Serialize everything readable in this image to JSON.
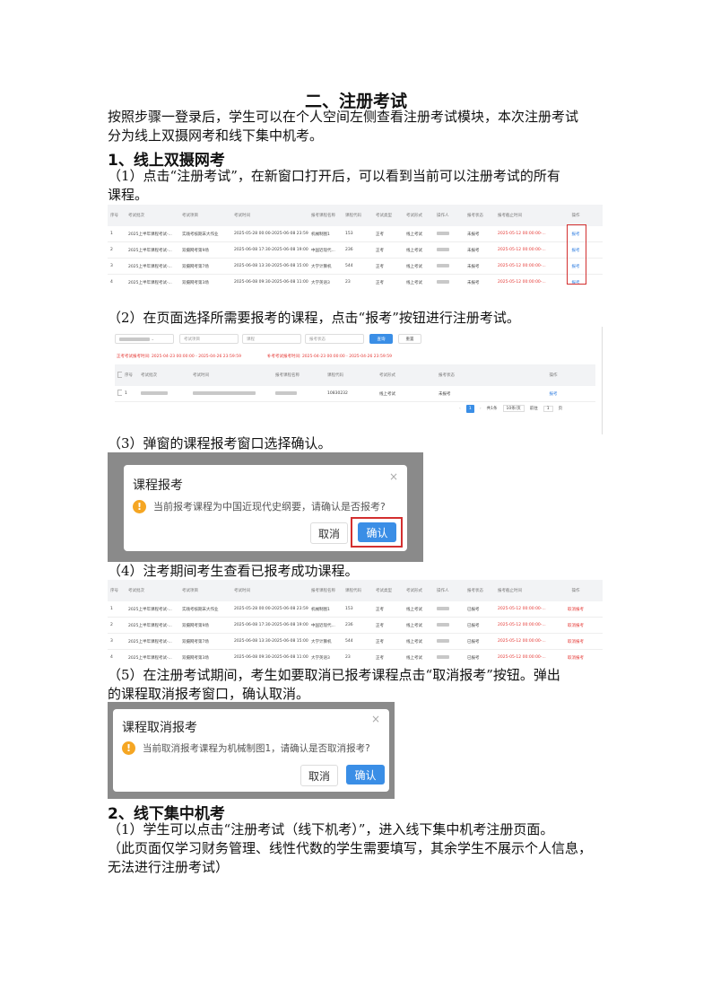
{
  "section_title": "二、注册考试",
  "intro": [
    "按照步骤一登录后，学生可以在个人空间左侧查看注册考试模块，本次注册考试",
    "分为线上双摄网考和线下集中机考。"
  ],
  "online": {
    "heading": "1、线上双摄网考",
    "step1": [
      "（1）点击“注册考试”，在新窗口打开后，可以看到当前可以注册考试的所有",
      "课程。"
    ],
    "step2": "（2）在页面选择所需要报考的课程，点击“报考”按钮进行注册考试。",
    "step3": "（3）弹窗的课程报考窗口选择确认。",
    "step4": "（4）注考期间考生查看已报考成功课程。",
    "step5": [
      "（5）在注册考试期间，考生如要取消已报考课程点击“取消报考”按钮。弹出",
      "的课程取消报考窗口，确认取消。"
    ]
  },
  "offline": {
    "heading": "2、线下集中机考",
    "step1": [
      "（1）学生可以点击“注册考试（线下机考）”，进入线下集中机考注册页面。",
      "（此页面仅学习财务管理、线性代数的学生需要填写，其余学生不展示个人信息，",
      "无法进行注册考试）"
    ]
  },
  "table1": {
    "headers": [
      "序号",
      "考试批次",
      "考试项目",
      "考试时间",
      "报考课程名称",
      "课程代码",
      "考试类型",
      "考试形式",
      "操作人",
      "报考状态",
      "报考截止时间",
      "操作"
    ],
    "rows": [
      [
        "1",
        "2025上半年课程考试-...",
        "实践考核期末大作业",
        "2025-05-28 00:00-2025-06-08 23:59",
        "机械制图1",
        "153",
        "正考",
        "线上考试",
        "",
        "未报考",
        "2025-05-12 00:00:00-...",
        "报考"
      ],
      [
        "2",
        "2025上半年课程考试-...",
        "双摄网考第9场",
        "2025-06-08 17:30-2025-06-08 19:00",
        "中国近现代...",
        "236",
        "正考",
        "线上考试",
        "",
        "未报考",
        "2025-05-12 00:00:00-...",
        "报考"
      ],
      [
        "3",
        "2025上半年课程考试-...",
        "双摄网考第7场",
        "2025-06-08 13:30-2025-06-08 15:00",
        "大学计算机",
        "544",
        "正考",
        "线上考试",
        "",
        "未报考",
        "2025-05-12 00:00:00-...",
        "报考"
      ],
      [
        "4",
        "2025上半年课程考试-...",
        "双摄网考第3场",
        "2025-06-08 09:30-2025-06-08 11:00",
        "大学英语3",
        "23",
        "正考",
        "线上考试",
        "",
        "未报考",
        "2025-05-12 00:00:00-...",
        "报考"
      ]
    ]
  },
  "filter": {
    "sel1": "考试项目",
    "sel2": "课程",
    "sel3": "报考状态",
    "search": "查询",
    "reset": "重置",
    "period1": "正考考试报考时间: 2025-04-23 00:00:00 - 2025-04-26 23:59:59",
    "period2": "补考考试报考时间: 2025-04-23 00:00:00 - 2025-04-26 23:59:59"
  },
  "table2": {
    "headers": [
      "序号",
      "考试批次",
      "考试时间",
      "报考课程名称",
      "课程代码",
      "考试形式",
      "报考状态",
      "操作"
    ],
    "row": [
      "1",
      "",
      "",
      "",
      "10830232",
      "线上考试",
      "未报考",
      "报考"
    ]
  },
  "pagination": {
    "page": "1",
    "total": "共1条",
    "size": "10条/页",
    "goto": "前往",
    "goto_page": "1",
    "unit": "页"
  },
  "modal1": {
    "title": "课程报考",
    "message": "当前报考课程为中国近现代史纲要，请确认是否报考?",
    "cancel": "取消",
    "ok": "确认"
  },
  "table3": {
    "headers": [
      "序号",
      "考试批次",
      "考试项目",
      "考试时间",
      "报考课程名称",
      "课程代码",
      "考试类型",
      "考试形式",
      "操作人",
      "报考状态",
      "报考截止时间",
      "操作"
    ],
    "rows": [
      [
        "1",
        "2025上半年课程考试-...",
        "实践考核期末大作业",
        "2025-05-28 00:00-2025-06-08 23:59",
        "机械制图1",
        "153",
        "正考",
        "线上考试",
        "",
        "已报考",
        "2025-05-12 00:00:00-...",
        "取消报考"
      ],
      [
        "2",
        "2025上半年课程考试-...",
        "双摄网考第9场",
        "2025-06-08 17:30-2025-06-08 19:00",
        "中国近现代...",
        "236",
        "正考",
        "线上考试",
        "",
        "已报考",
        "2025-05-12 00:00:00-...",
        "取消报考"
      ],
      [
        "3",
        "2025上半年课程考试-...",
        "双摄网考第7场",
        "2025-06-08 13:30-2025-06-08 15:00",
        "大学计算机",
        "544",
        "正考",
        "线上考试",
        "",
        "已报考",
        "2025-05-12 00:00:00-...",
        "取消报考"
      ],
      [
        "4",
        "2025上半年课程考试-...",
        "双摄网考第3场",
        "2025-06-08 09:30-2025-06-08 11:00",
        "大学英语3",
        "23",
        "正考",
        "线上考试",
        "",
        "已报考",
        "2025-05-12 00:00:00-...",
        "取消报考"
      ]
    ]
  },
  "modal2": {
    "title": "课程取消报考",
    "message": "当前取消报考课程为机械制图1，请确认是否取消报考?",
    "cancel": "取消",
    "ok": "确认"
  },
  "colors": {
    "red": "#e53935",
    "blue": "#2f7de1",
    "warning": "#f5a623",
    "primary_button": "#3a8ee6",
    "highlight_box": "#d32f2f"
  }
}
